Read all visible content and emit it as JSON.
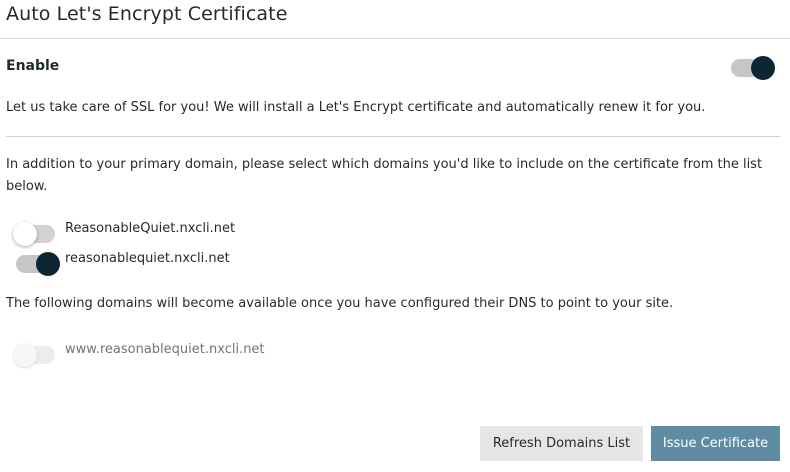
{
  "header": {
    "title": "Auto Let's Encrypt Certificate"
  },
  "enable": {
    "label": "Enable",
    "state": "on"
  },
  "description": "Let us take care of SSL for you! We will install a Let's Encrypt certificate and automatically renew it for you.",
  "domains_section": {
    "instructions": "In addition to your primary domain, please select which domains you'd like to include on the certificate from the list below.",
    "domains": [
      {
        "name": "ReasonableQuiet.nxcli.net",
        "state": "off"
      },
      {
        "name": "reasonablequiet.nxcli.net",
        "state": "on"
      }
    ]
  },
  "pending_section": {
    "instructions": "The following domains will become available once you have configured their DNS to point to your site.",
    "domains": [
      {
        "name": "www.reasonablequiet.nxcli.net",
        "state": "disabled"
      }
    ]
  },
  "actions": {
    "refresh_label": "Refresh Domains List",
    "issue_label": "Issue Certificate"
  },
  "colors": {
    "toggle_on_knob": "#0e2634",
    "primary_button": "#5f8ca3",
    "secondary_button": "#e6e6e6"
  }
}
